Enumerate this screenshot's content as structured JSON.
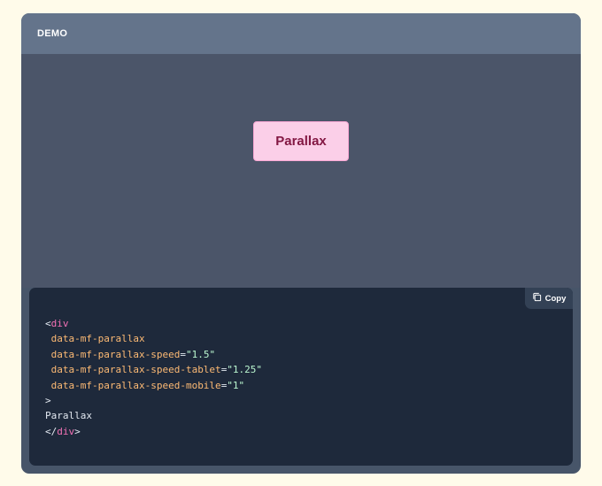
{
  "header": {
    "title": "DEMO"
  },
  "demo": {
    "box_label": "Parallax"
  },
  "code": {
    "copy_label": "Copy",
    "open_tag_start": "<",
    "tag_name": "div",
    "attrs": [
      {
        "name": "data-mf-parallax",
        "value": null
      },
      {
        "name": "data-mf-parallax-speed",
        "value": "\"1.5\""
      },
      {
        "name": "data-mf-parallax-speed-tablet",
        "value": "\"1.25\""
      },
      {
        "name": "data-mf-parallax-speed-mobile",
        "value": "\"1\""
      }
    ],
    "equals": "=",
    "open_tag_end": ">",
    "content": "Parallax",
    "close_tag_start": "</",
    "close_tag_end": ">"
  },
  "colors": {
    "page_bg": "#fffbea",
    "card_bg": "#475569",
    "header_bg": "#64748b",
    "box_bg": "#fbcfe8",
    "box_text": "#831843",
    "code_bg": "#1e293b",
    "tag": "#f472b6",
    "attr": "#fdba74",
    "string": "#bbf7d0"
  },
  "icons": {
    "copy": "copy-icon"
  }
}
